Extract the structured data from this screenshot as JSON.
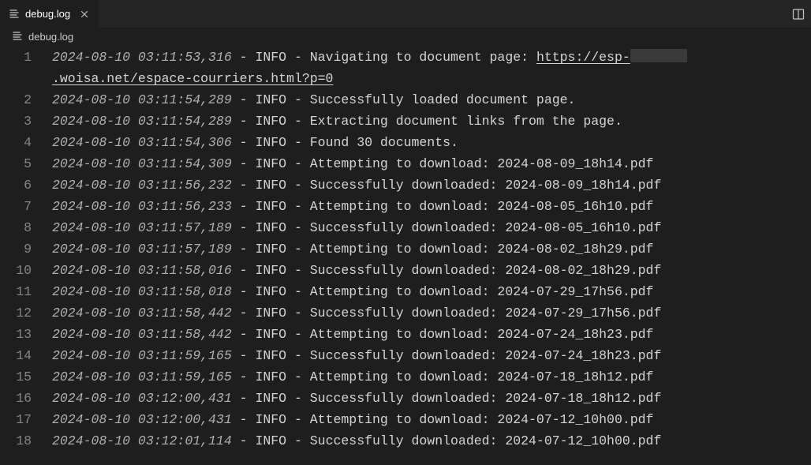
{
  "tab": {
    "label": "debug.log"
  },
  "breadcrumb": {
    "filename": "debug.log"
  },
  "log": {
    "url_prefix": "https://esp-",
    "url_suffix": ".woisa.net/espace-courriers.html?p=0",
    "lines": [
      {
        "n": "1",
        "ts": "2024-08-10 03:11:53,316",
        "sep": " - INFO - ",
        "msg": "Navigating to document page: ",
        "url": true
      },
      {
        "n": "2",
        "ts": "2024-08-10 03:11:54,289",
        "sep": " - INFO - ",
        "msg": "Successfully loaded document page."
      },
      {
        "n": "3",
        "ts": "2024-08-10 03:11:54,289",
        "sep": " - INFO - ",
        "msg": "Extracting document links from the page."
      },
      {
        "n": "4",
        "ts": "2024-08-10 03:11:54,306",
        "sep": " - INFO - ",
        "msg": "Found 30 documents."
      },
      {
        "n": "5",
        "ts": "2024-08-10 03:11:54,309",
        "sep": " - INFO - ",
        "msg": "Attempting to download: 2024-08-09_18h14.pdf"
      },
      {
        "n": "6",
        "ts": "2024-08-10 03:11:56,232",
        "sep": " - INFO - ",
        "msg": "Successfully downloaded: 2024-08-09_18h14.pdf"
      },
      {
        "n": "7",
        "ts": "2024-08-10 03:11:56,233",
        "sep": " - INFO - ",
        "msg": "Attempting to download: 2024-08-05_16h10.pdf"
      },
      {
        "n": "8",
        "ts": "2024-08-10 03:11:57,189",
        "sep": " - INFO - ",
        "msg": "Successfully downloaded: 2024-08-05_16h10.pdf"
      },
      {
        "n": "9",
        "ts": "2024-08-10 03:11:57,189",
        "sep": " - INFO - ",
        "msg": "Attempting to download: 2024-08-02_18h29.pdf"
      },
      {
        "n": "10",
        "ts": "2024-08-10 03:11:58,016",
        "sep": " - INFO - ",
        "msg": "Successfully downloaded: 2024-08-02_18h29.pdf"
      },
      {
        "n": "11",
        "ts": "2024-08-10 03:11:58,018",
        "sep": " - INFO - ",
        "msg": "Attempting to download: 2024-07-29_17h56.pdf"
      },
      {
        "n": "12",
        "ts": "2024-08-10 03:11:58,442",
        "sep": " - INFO - ",
        "msg": "Successfully downloaded: 2024-07-29_17h56.pdf"
      },
      {
        "n": "13",
        "ts": "2024-08-10 03:11:58,442",
        "sep": " - INFO - ",
        "msg": "Attempting to download: 2024-07-24_18h23.pdf"
      },
      {
        "n": "14",
        "ts": "2024-08-10 03:11:59,165",
        "sep": " - INFO - ",
        "msg": "Successfully downloaded: 2024-07-24_18h23.pdf"
      },
      {
        "n": "15",
        "ts": "2024-08-10 03:11:59,165",
        "sep": " - INFO - ",
        "msg": "Attempting to download: 2024-07-18_18h12.pdf"
      },
      {
        "n": "16",
        "ts": "2024-08-10 03:12:00,431",
        "sep": " - INFO - ",
        "msg": "Successfully downloaded: 2024-07-18_18h12.pdf"
      },
      {
        "n": "17",
        "ts": "2024-08-10 03:12:00,431",
        "sep": " - INFO - ",
        "msg": "Attempting to download: 2024-07-12_10h00.pdf"
      },
      {
        "n": "18",
        "ts": "2024-08-10 03:12:01,114",
        "sep": " - INFO - ",
        "msg": "Successfully downloaded: 2024-07-12_10h00.pdf"
      }
    ]
  }
}
